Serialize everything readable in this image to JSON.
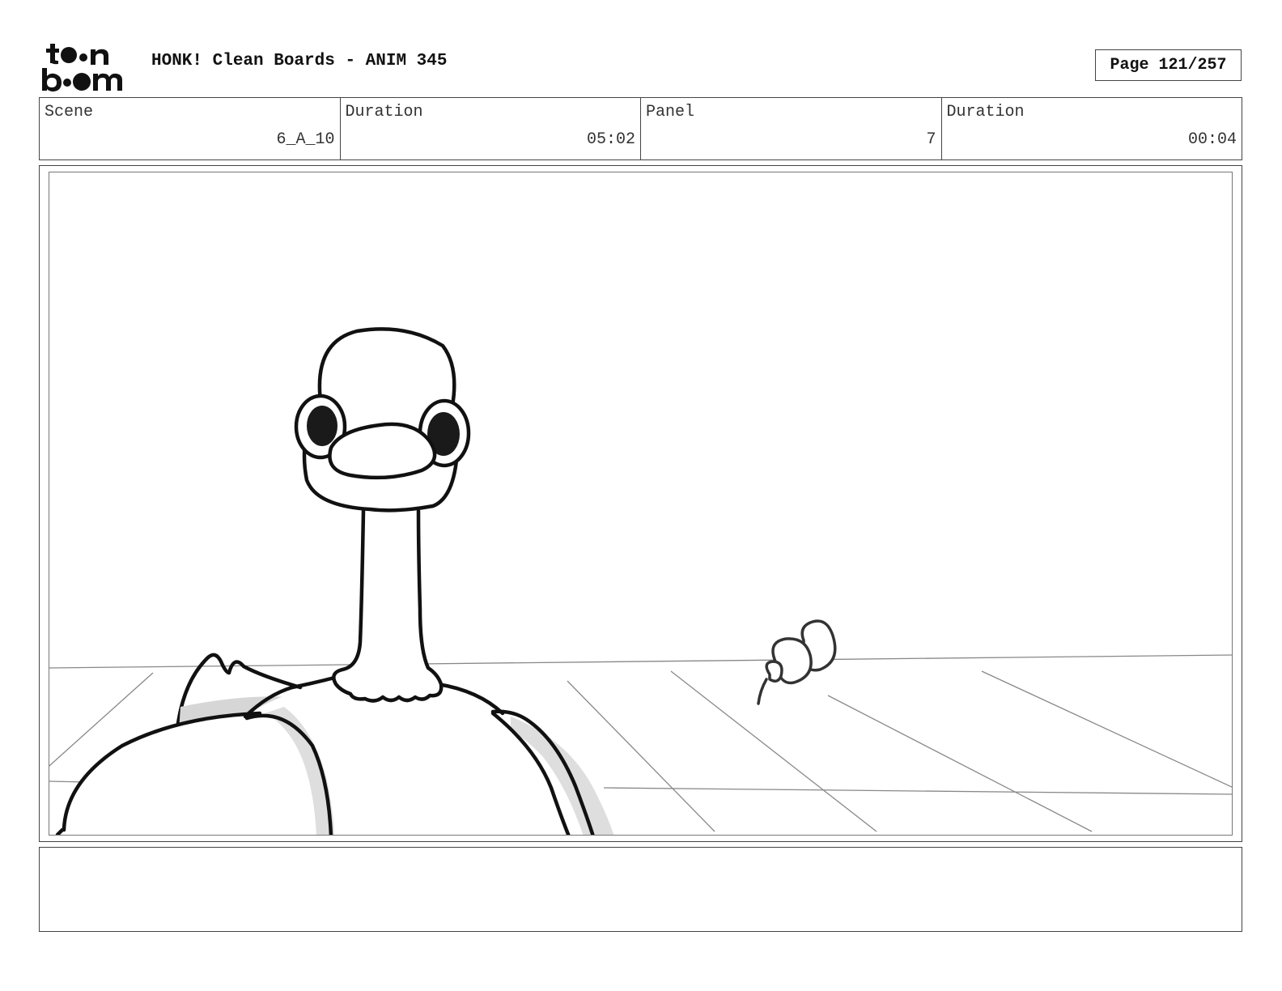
{
  "header": {
    "logo_text": "toon boom",
    "title": "HONK! Clean Boards - ANIM 345",
    "page": "Page 121/257"
  },
  "info": [
    {
      "label": "Scene",
      "value": "6_A_10"
    },
    {
      "label": "Duration",
      "value": "05:02"
    },
    {
      "label": "Panel",
      "value": "7"
    },
    {
      "label": "Duration",
      "value": "00:04"
    }
  ],
  "notes": {
    "text": ""
  }
}
